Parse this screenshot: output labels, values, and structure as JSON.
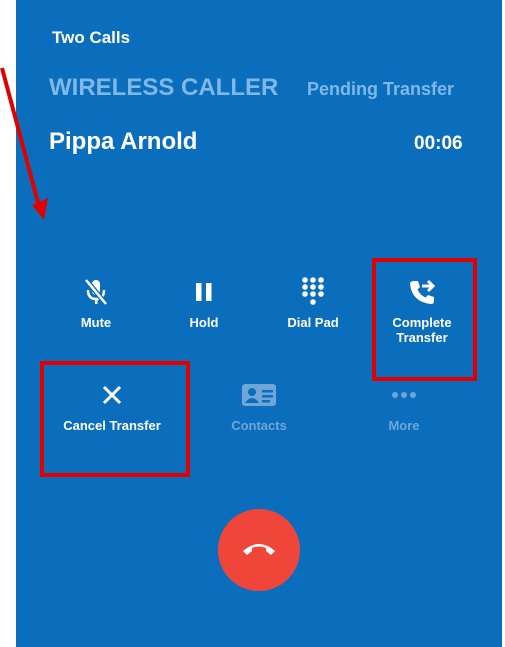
{
  "header": {
    "calls_count": "Two Calls",
    "caller_label": "WIRELESS CALLER",
    "status": "Pending Transfer",
    "caller_name": "Pippa Arnold",
    "timer": "00:06"
  },
  "controls": {
    "mute": {
      "label": "Mute",
      "icon": "mic-off-icon"
    },
    "hold": {
      "label": "Hold",
      "icon": "pause-icon"
    },
    "dial_pad": {
      "label": "Dial Pad",
      "icon": "dialpad-icon"
    },
    "complete_transfer": {
      "label_line1": "Complete",
      "label_line2": "Transfer",
      "icon": "phone-forward-icon"
    },
    "cancel_transfer": {
      "label": "Cancel Transfer",
      "icon": "close-icon"
    },
    "contacts": {
      "label": "Contacts",
      "icon": "contact-card-icon"
    },
    "more": {
      "label": "More",
      "icon": "more-dots-icon"
    }
  },
  "hangup": {
    "icon": "hang-up-icon"
  },
  "colors": {
    "background": "#0a6ebd",
    "highlight": "#e10000",
    "hangup": "#f0463a",
    "muted_text": "#7fb7e6"
  }
}
